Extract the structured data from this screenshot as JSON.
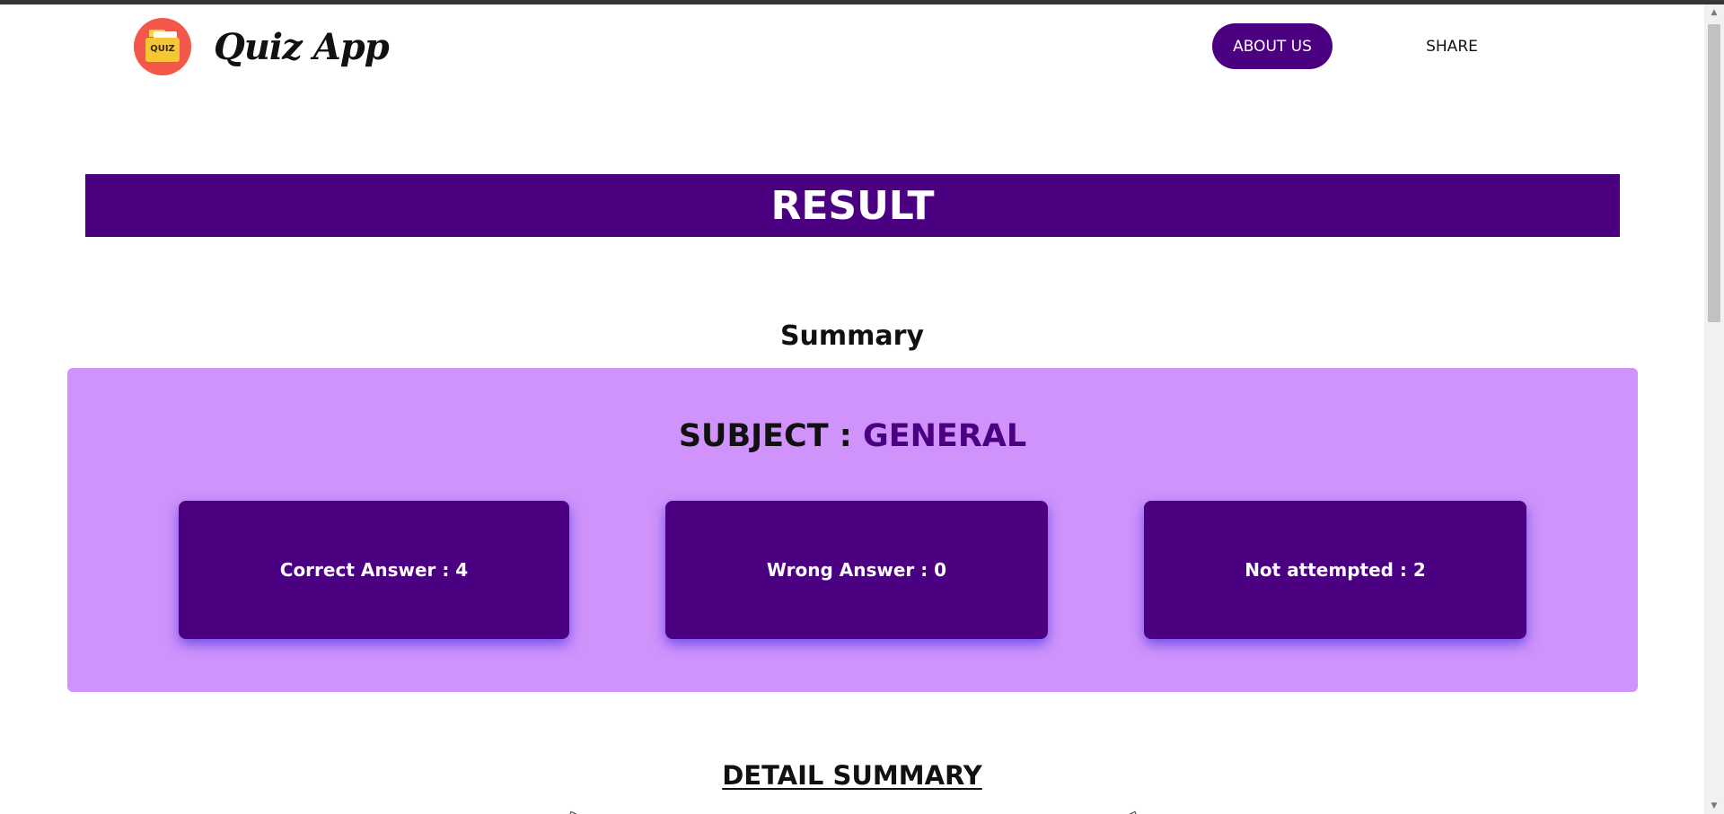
{
  "header": {
    "logo_text": "QUIZ",
    "app_title": "Quiz App",
    "nav": {
      "about_label": "ABOUT US",
      "share_label": "SHARE"
    }
  },
  "result": {
    "banner_title": "RESULT",
    "summary_heading": "Summary",
    "subject_label": "SUBJECT : ",
    "subject_value": "GENERAL",
    "stats": {
      "correct": "Correct Answer : 4",
      "wrong": "Wrong Answer : 0",
      "not_attempted": "Not attempted : 2"
    },
    "detail_heading": "DETAIL SUMMARY"
  },
  "colors": {
    "primary": "#4b0082",
    "panel": "#cf93fb",
    "card_glow": "#5a3ce6"
  },
  "icons": {
    "logo": "quiz-folder-icon",
    "scroll_up": "arrow-up-icon",
    "scroll_down": "arrow-down-icon"
  }
}
